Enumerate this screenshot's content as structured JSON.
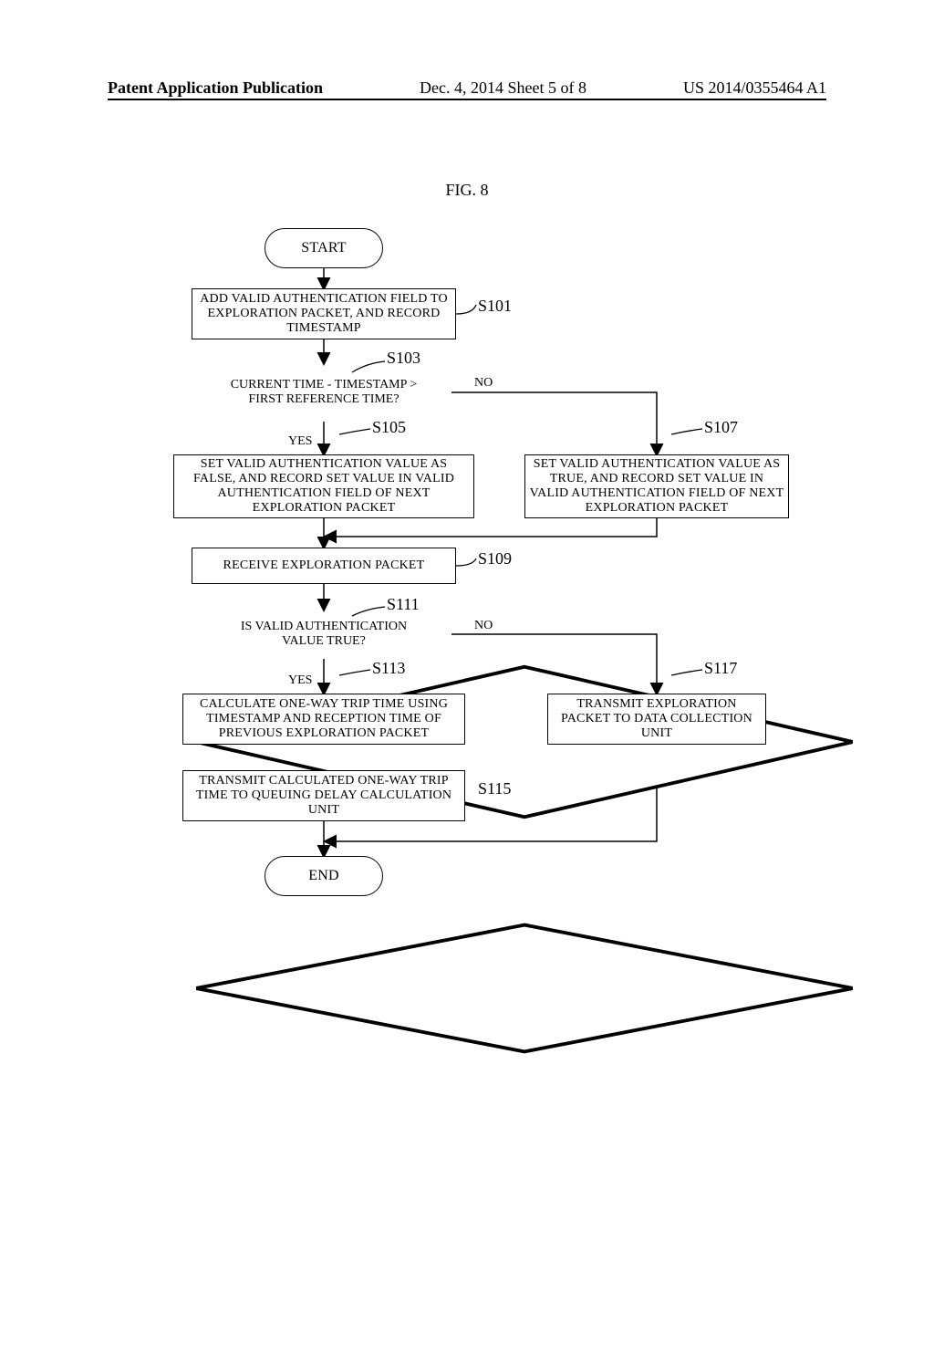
{
  "header": {
    "left": "Patent Application Publication",
    "mid": "Dec. 4, 2014   Sheet 5 of 8",
    "right": "US 2014/0355464 A1"
  },
  "figure_label": "FIG. 8",
  "terminals": {
    "start": "START",
    "end": "END"
  },
  "steps": {
    "s101": "ADD VALID AUTHENTICATION FIELD TO EXPLORATION PACKET, AND RECORD TIMESTAMP",
    "s103": "CURRENT TIME - TIMESTAMP > FIRST REFERENCE TIME?",
    "s105": "SET VALID AUTHENTICATION VALUE AS FALSE, AND RECORD SET VALUE IN VALID AUTHENTICATION FIELD OF NEXT EXPLORATION PACKET",
    "s107": "SET VALID AUTHENTICATION VALUE AS TRUE, AND RECORD SET VALUE IN VALID AUTHENTICATION FIELD OF NEXT EXPLORATION PACKET",
    "s109": "RECEIVE EXPLORATION PACKET",
    "s111": "IS VALID AUTHENTICATION VALUE TRUE?",
    "s113": "CALCULATE ONE-WAY TRIP TIME USING TIMESTAMP AND RECEPTION TIME OF PREVIOUS EXPLORATION PACKET",
    "s115": "TRANSMIT CALCULATED ONE-WAY TRIP TIME TO QUEUING DELAY CALCULATION UNIT",
    "s117": "TRANSMIT EXPLORATION PACKET TO DATA COLLECTION UNIT"
  },
  "step_labels": {
    "s101": "S101",
    "s103": "S103",
    "s105": "S105",
    "s107": "S107",
    "s109": "S109",
    "s111": "S111",
    "s113": "S113",
    "s115": "S115",
    "s117": "S117"
  },
  "branch_labels": {
    "yes1": "YES",
    "no1": "NO",
    "yes2": "YES",
    "no2": "NO"
  },
  "chart_data": {
    "type": "diagram",
    "kind": "flowchart",
    "nodes": [
      {
        "id": "start",
        "type": "terminal",
        "label": "START"
      },
      {
        "id": "S101",
        "type": "process",
        "label": "ADD VALID AUTHENTICATION FIELD TO EXPLORATION PACKET, AND RECORD TIMESTAMP"
      },
      {
        "id": "S103",
        "type": "decision",
        "label": "CURRENT TIME - TIMESTAMP > FIRST REFERENCE TIME?"
      },
      {
        "id": "S105",
        "type": "process",
        "label": "SET VALID AUTHENTICATION VALUE AS FALSE, AND RECORD SET VALUE IN VALID AUTHENTICATION FIELD OF NEXT EXPLORATION PACKET"
      },
      {
        "id": "S107",
        "type": "process",
        "label": "SET VALID AUTHENTICATION VALUE AS TRUE, AND RECORD SET VALUE IN VALID AUTHENTICATION FIELD OF NEXT EXPLORATION PACKET"
      },
      {
        "id": "S109",
        "type": "process",
        "label": "RECEIVE EXPLORATION PACKET"
      },
      {
        "id": "S111",
        "type": "decision",
        "label": "IS VALID AUTHENTICATION VALUE TRUE?"
      },
      {
        "id": "S113",
        "type": "process",
        "label": "CALCULATE ONE-WAY TRIP TIME USING TIMESTAMP AND RECEPTION TIME OF PREVIOUS EXPLORATION PACKET"
      },
      {
        "id": "S115",
        "type": "process",
        "label": "TRANSMIT CALCULATED ONE-WAY TRIP TIME TO QUEUING DELAY CALCULATION UNIT"
      },
      {
        "id": "S117",
        "type": "process",
        "label": "TRANSMIT EXPLORATION PACKET TO DATA COLLECTION UNIT"
      },
      {
        "id": "end",
        "type": "terminal",
        "label": "END"
      }
    ],
    "edges": [
      {
        "from": "start",
        "to": "S101"
      },
      {
        "from": "S101",
        "to": "S103"
      },
      {
        "from": "S103",
        "to": "S105",
        "label": "YES"
      },
      {
        "from": "S103",
        "to": "S107",
        "label": "NO"
      },
      {
        "from": "S105",
        "to": "S109"
      },
      {
        "from": "S107",
        "to": "S109"
      },
      {
        "from": "S109",
        "to": "S111"
      },
      {
        "from": "S111",
        "to": "S113",
        "label": "YES"
      },
      {
        "from": "S111",
        "to": "S117",
        "label": "NO"
      },
      {
        "from": "S113",
        "to": "S115"
      },
      {
        "from": "S115",
        "to": "end"
      },
      {
        "from": "S117",
        "to": "end"
      }
    ]
  }
}
